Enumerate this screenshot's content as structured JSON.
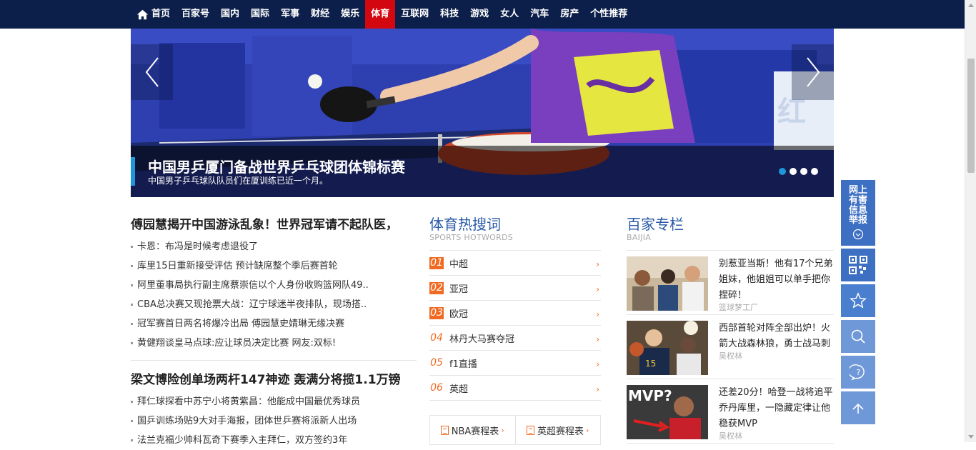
{
  "nav": {
    "items": [
      {
        "label": "首页",
        "icon": "home-icon"
      },
      {
        "label": "百家号"
      },
      {
        "label": "国内"
      },
      {
        "label": "国际"
      },
      {
        "label": "军事"
      },
      {
        "label": "财经"
      },
      {
        "label": "娱乐"
      },
      {
        "label": "体育",
        "active": true
      },
      {
        "label": "互联网"
      },
      {
        "label": "科技"
      },
      {
        "label": "游戏"
      },
      {
        "label": "女人"
      },
      {
        "label": "汽车"
      },
      {
        "label": "房产"
      },
      {
        "label": "个性推荐"
      }
    ],
    "active_color": "#d2070f",
    "bg_color": "#0c1f4a"
  },
  "slider": {
    "title": "中国男乒厦门备战世界乒乓球团体锦标赛",
    "subtitle": "中国男子乒乓球队队员们在厦训练已近一个月。",
    "slide_count": 4,
    "active_slide": 1
  },
  "left": {
    "headline1": "傅园慧揭开中国游泳乱象！世界冠军请不起队医，",
    "list1": [
      "卡恩：布冯是时候考虑退役了",
      "库里15日重新接受评估 预计缺席整个季后赛首轮",
      "阿里董事局执行副主席蔡崇信以个人身份收购篮网队49..",
      "CBA总决赛又现抢票大战：辽宁球迷半夜排队，现场搭..",
      "冠军赛首日两名将爆冷出局 傅园慧史婧琳无缘决赛",
      "黄健翔谈皇马点球:应让球员决定比赛 网友:双标!"
    ],
    "headline2": "梁文博险创单场两杆147神迹 轰满分将揽1.1万镑",
    "list2": [
      "拜仁球探看中苏宁小将黄紫昌：他能成中国最优秀球员",
      "国乒训练场贴9大对手海报，团体世乒赛将派新人出场",
      "法兰克福少帅科瓦奇下赛季入主拜仁，双方签约3年"
    ]
  },
  "hot": {
    "title": "体育热搜词",
    "subtitle": "SPORTS HOTWORDS",
    "items": [
      {
        "rank": "01",
        "label": "中超"
      },
      {
        "rank": "02",
        "label": "亚冠"
      },
      {
        "rank": "03",
        "label": "欧冠"
      },
      {
        "rank": "04",
        "label": "林丹大马赛夺冠"
      },
      {
        "rank": "05",
        "label": "f1直播"
      },
      {
        "rank": "06",
        "label": "英超"
      }
    ],
    "schedule": [
      {
        "label": "NBA赛程表"
      },
      {
        "label": "英超赛程表"
      }
    ],
    "accent_color": "#f26a21"
  },
  "baijia": {
    "title": "百家专栏",
    "subtitle": "BAIJIA",
    "items": [
      {
        "title": "别惹亚当斯！他有17个兄弟姐妹，他姐姐可以单手把你捏碎！",
        "author": "篮球梦工厂"
      },
      {
        "title": "西部首轮对阵全部出炉！火箭大战森林狼，勇士战马刺",
        "author": "吴权林"
      },
      {
        "title": "还差20分！哈登一战将追平乔丹库里，一隐藏定律让他稳获MVP",
        "author": "吴权林",
        "thumb_text": "MVP?"
      }
    ]
  },
  "float_bar": {
    "report_label": "网上有害信息举报",
    "buttons": [
      "qr-code-icon",
      "star-icon",
      "search-icon",
      "chat-icon",
      "back-to-top-icon"
    ]
  }
}
